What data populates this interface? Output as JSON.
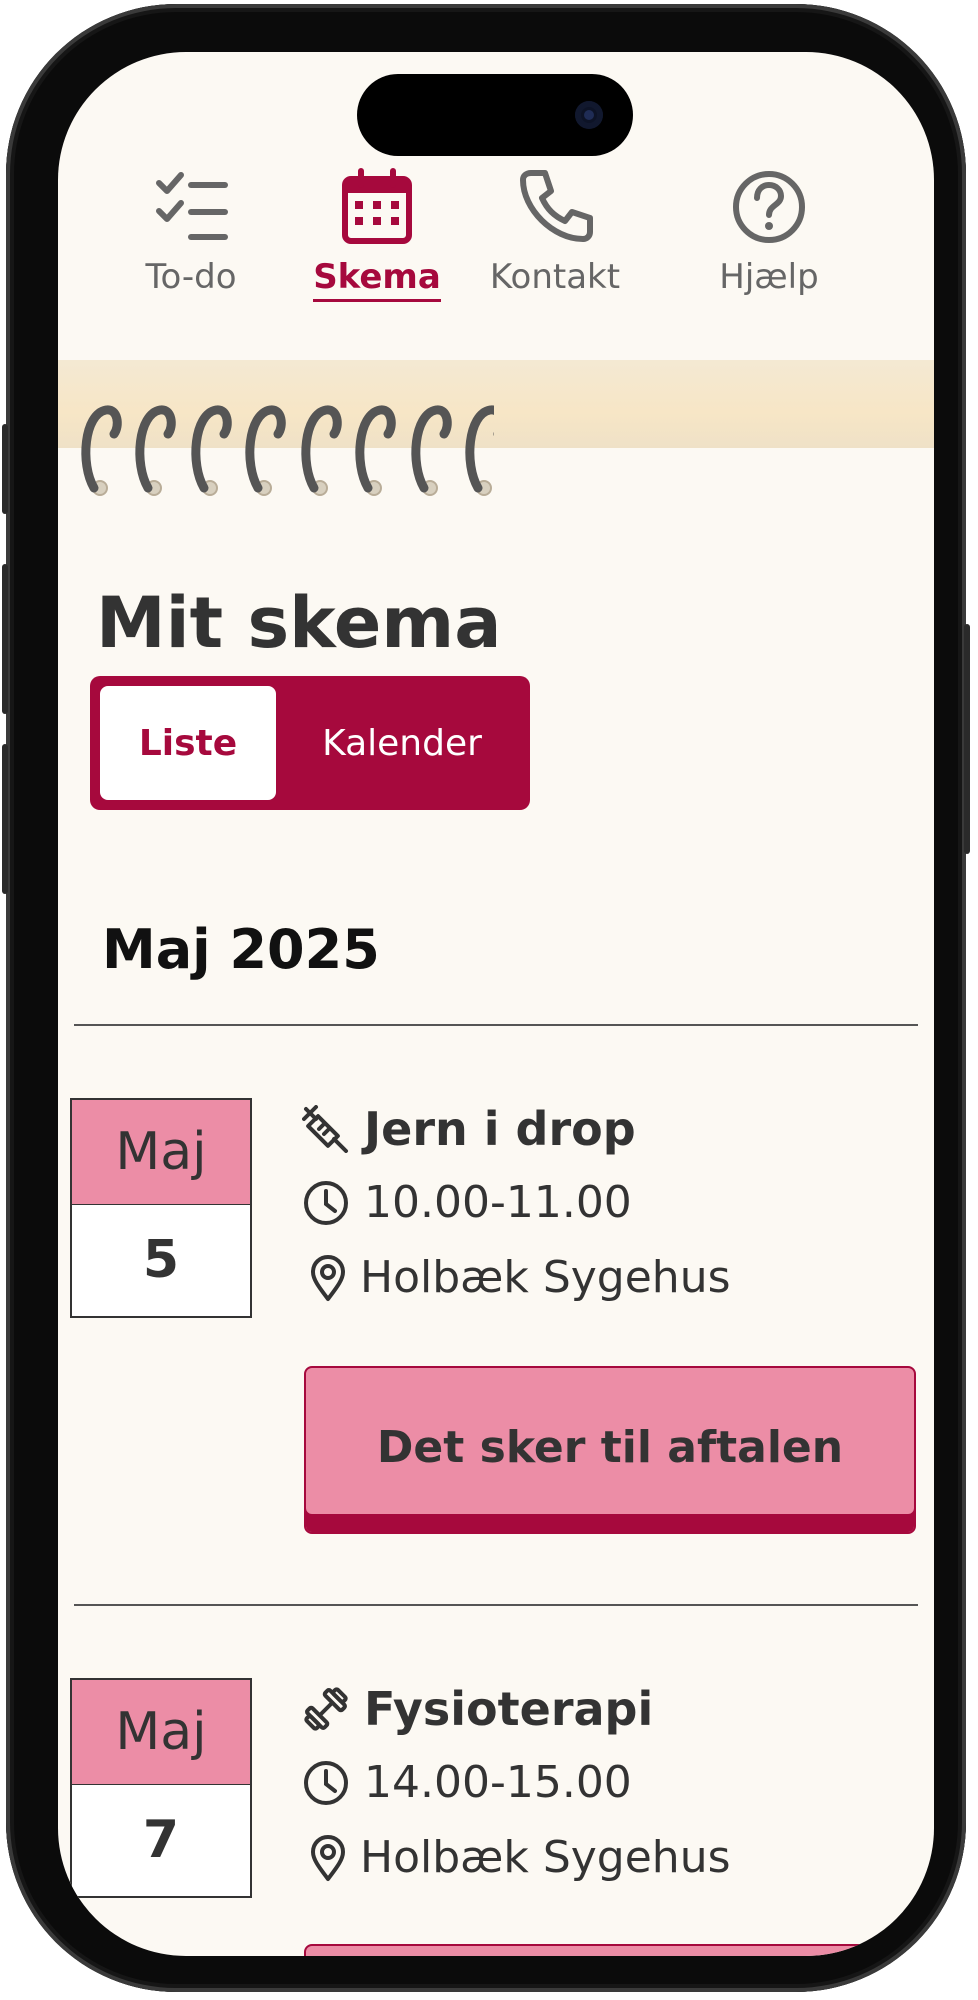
{
  "nav": {
    "items": [
      {
        "label": "To-do",
        "icon": "checklist-icon"
      },
      {
        "label": "Skema",
        "icon": "calendar-icon",
        "active": true
      },
      {
        "label": "Kontakt",
        "icon": "phone-icon"
      },
      {
        "label": "Hjælp",
        "icon": "help-icon"
      }
    ]
  },
  "page": {
    "title": "Mit skema",
    "view_toggle": {
      "active": "Liste",
      "inactive": "Kalender"
    },
    "month_heading": "Maj 2025"
  },
  "events": [
    {
      "month": "Maj",
      "day": "5",
      "title": "Jern i drop",
      "type_icon": "syringe-icon",
      "time": "10.00-11.00",
      "location": "Holbæk Sygehus",
      "button": "Det sker til aftalen"
    },
    {
      "month": "Maj",
      "day": "7",
      "title": "Fysioterapi",
      "type_icon": "dumbbell-icon",
      "time": "14.00-15.00",
      "location": "Holbæk Sygehus"
    }
  ],
  "colors": {
    "accent": "#a6093d",
    "accent_light": "#ec8da6",
    "background": "#fcf9f3"
  }
}
